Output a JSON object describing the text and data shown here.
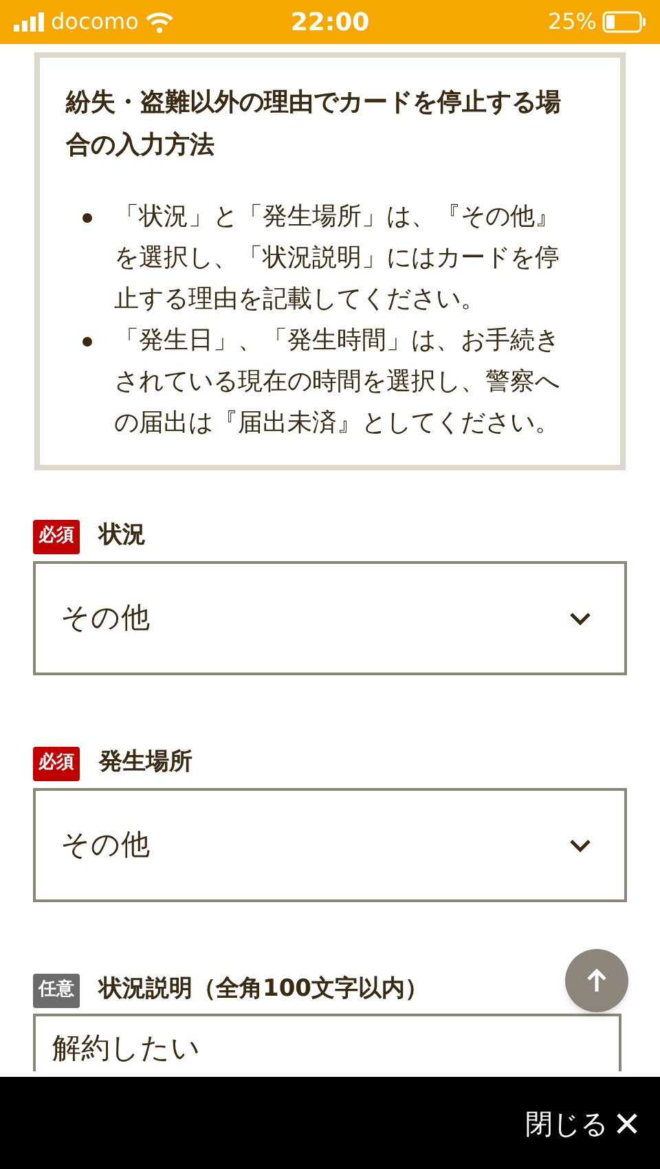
{
  "status_bar": {
    "carrier": "docomo",
    "time": "22:00",
    "battery": "25%"
  },
  "notice": {
    "title": "紛失・盗難以外の理由でカードを停止する場合の入力方法",
    "bullets": [
      "「状況」と「発生場所」は、『その他』を選択し、「状況説明」にはカードを停止する理由を記載してください。",
      "「発生日」、「発生時間」は、お手続きされている現在の時間を選択し、警察への届出は『届出未済』としてください。"
    ]
  },
  "fields": [
    {
      "kind": "select",
      "badge": {
        "kind": "required",
        "text": "必須"
      },
      "label": "状況",
      "value": "その他"
    },
    {
      "kind": "select",
      "badge": {
        "kind": "required",
        "text": "必須"
      },
      "label": "発生場所",
      "value": "その他"
    },
    {
      "kind": "textarea",
      "badge": {
        "kind": "optional",
        "text": "任意"
      },
      "label": "状況説明（全角100文字以内）",
      "value": "解約したい"
    }
  ],
  "bottom_bar": {
    "close": "閉じる"
  }
}
